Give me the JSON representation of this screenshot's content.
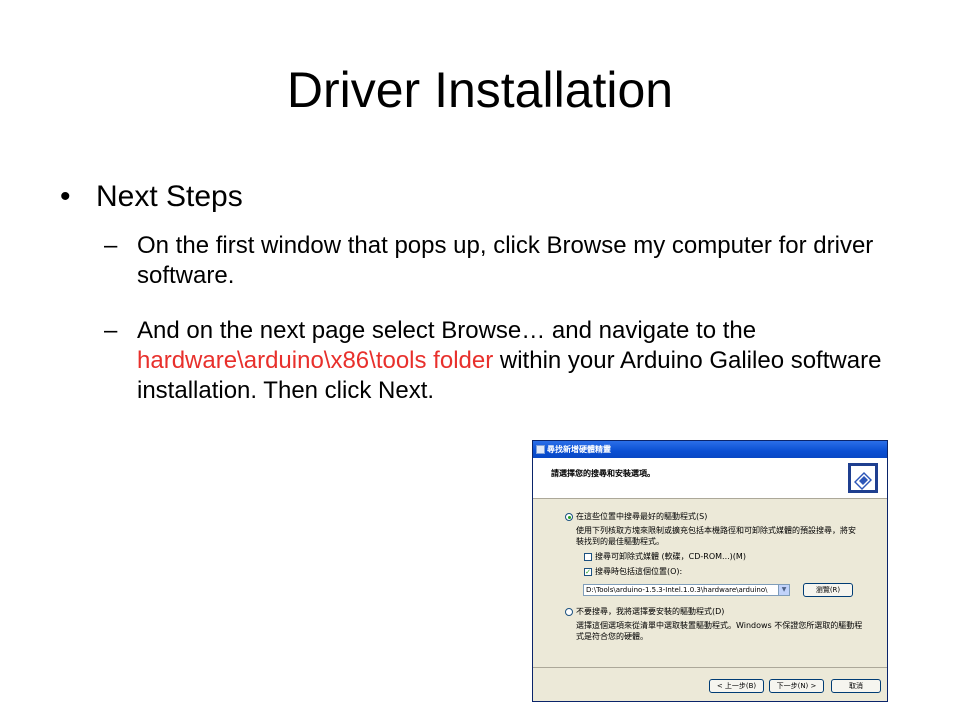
{
  "slide": {
    "title": "Driver Installation",
    "bullet": "Next Steps",
    "sub1": "On the first window that pops up, click Browse my computer for driver software.",
    "sub2_a": "And on the next page select Browse… and navigate to the ",
    "sub2_hl": "hardware\\arduino\\x86\\tools folder",
    "sub2_b": " within your Arduino Galileo software installation. Then click Next.",
    "bullet_symbol": "•",
    "dash_symbol": "–",
    "highlight_color": "#e8302c"
  },
  "dialog": {
    "title": "尋找新增硬體精靈",
    "header": "請選擇您的搜尋和安裝選項。",
    "opt1_label": "在這些位置中搜尋最好的驅動程式(S)",
    "opt1_desc_1": "使用下列核取方塊來限制或擴充包括本機路徑和可卸除式媒體的預設搜尋，將安",
    "opt1_desc_2": "裝找到的最佳驅動程式。",
    "chk1_label": "搜尋可卸除式媒體 (軟碟，CD-ROM...)(M)",
    "chk2_label": "搜尋時包括這個位置(O):",
    "path_value": "D:\\Tools\\arduino-1.5.3-Intel.1.0.3\\hardware\\arduino\\",
    "browse_label": "瀏覽(R)",
    "opt2_label": "不要搜尋，我將選擇要安裝的驅動程式(D)",
    "opt2_desc_1": "選擇這個選項來從清單中選取裝置驅動程式。Windows 不保證您所選取的驅動程",
    "opt2_desc_2": "式是符合您的硬體。",
    "back_label": "< 上一步(B)",
    "next_label": "下一步(N) >",
    "cancel_label": "取消"
  }
}
